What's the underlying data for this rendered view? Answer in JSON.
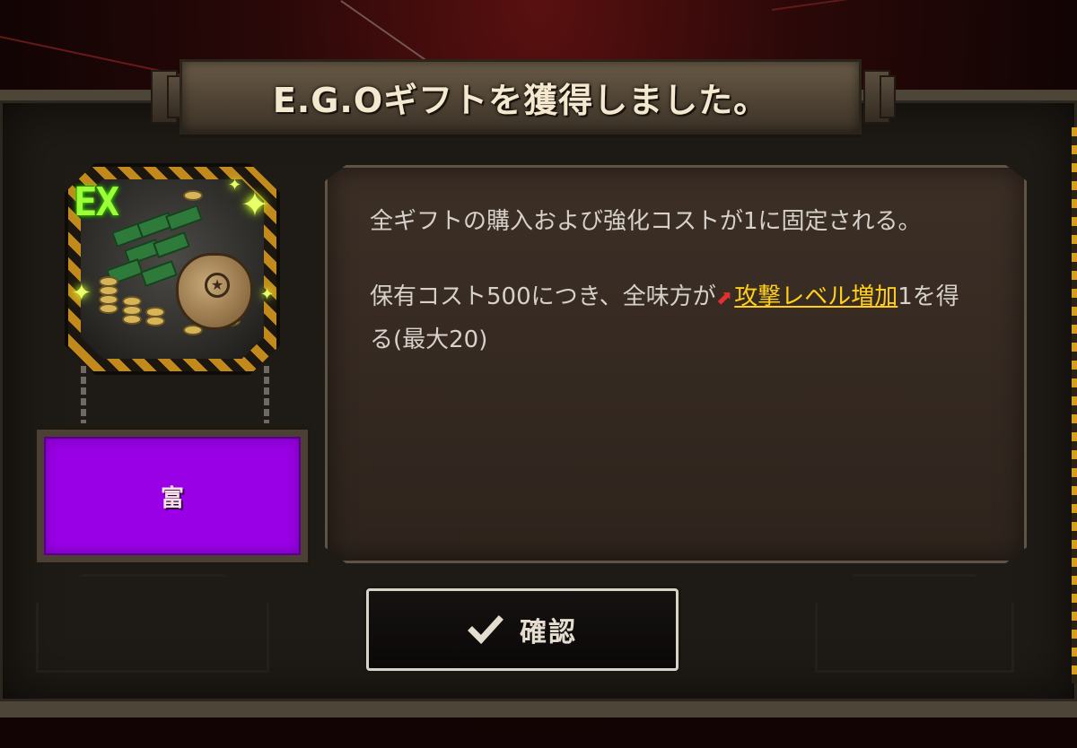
{
  "dialog": {
    "title": "E.G.Oギフトを獲得しました。"
  },
  "gift": {
    "grade_badge": "EX",
    "icon": "money-bag-icon",
    "keyword": "富",
    "keyword_color": "#9900e6"
  },
  "description": {
    "para1": "全ギフトの購入および強化コストが1に固定される。",
    "para2_prefix": "保有コスト500につき、全味方が",
    "para2_keyword": "攻撃レベル増加",
    "para2_suffix": "1を得る(最大20)",
    "keyword_icon": "attack-level-up-icon",
    "keyword_color": "#ffcf1a"
  },
  "actions": {
    "confirm_label": "確認",
    "confirm_icon": "check-icon"
  },
  "colors": {
    "accent_gold": "#c28a1d",
    "panel_bg": "#1e1a15"
  }
}
